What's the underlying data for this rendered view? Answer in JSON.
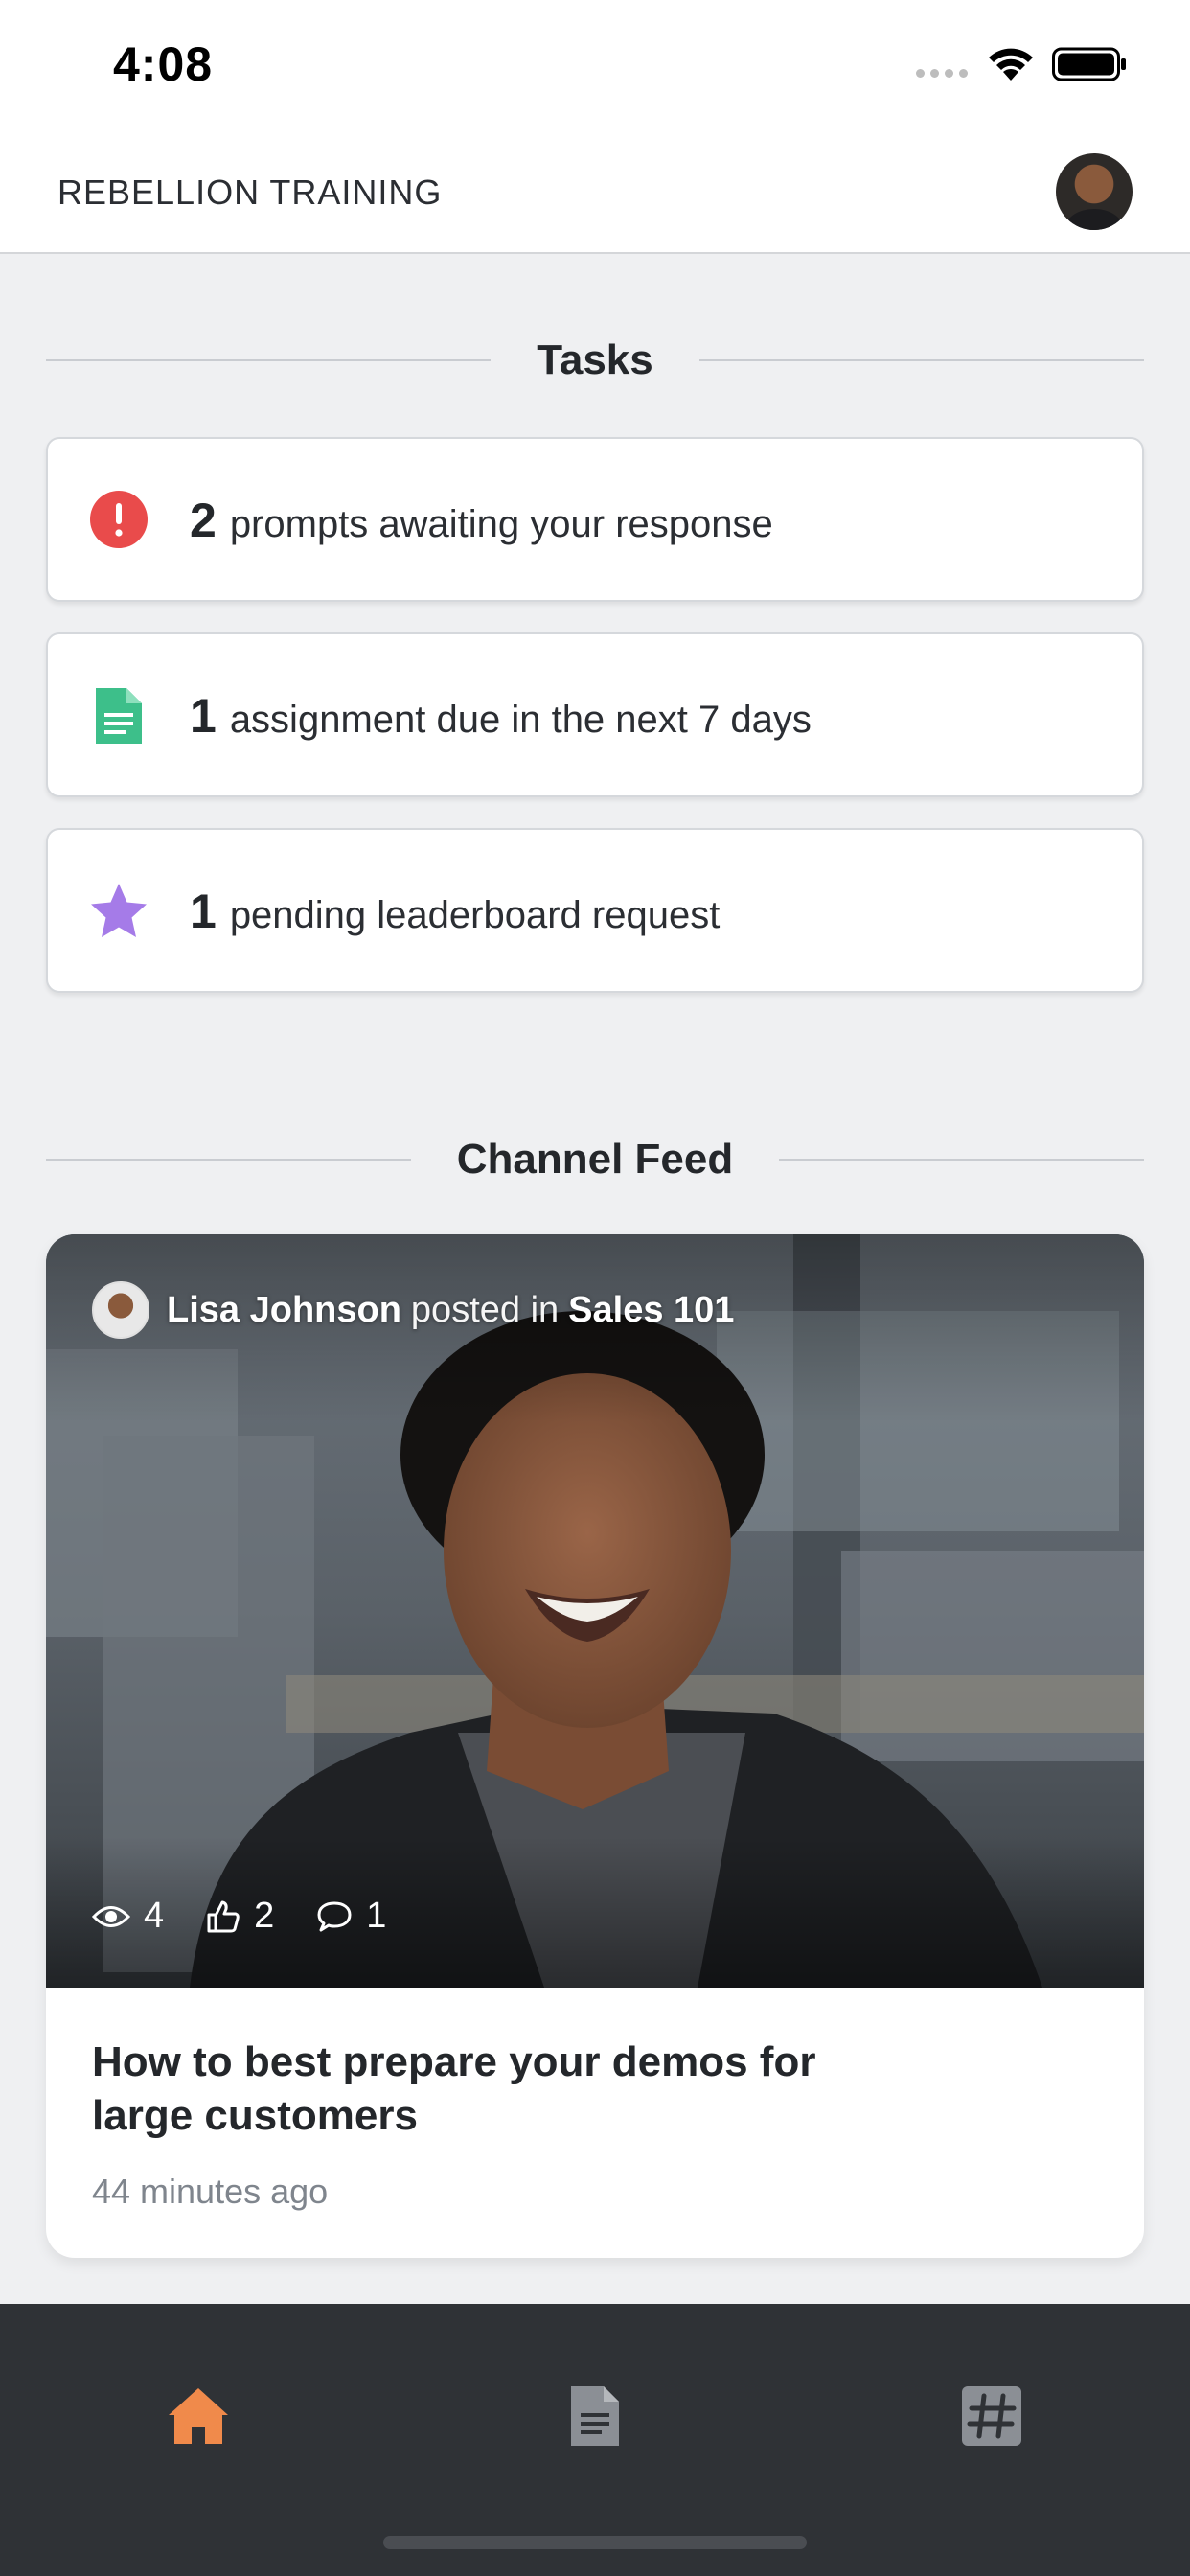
{
  "status_bar": {
    "time": "4:08"
  },
  "header": {
    "title": "REBELLION TRAINING"
  },
  "tasks_section": {
    "heading": "Tasks",
    "items": [
      {
        "count": "2",
        "text": "prompts awaiting your response",
        "icon": "alert-icon",
        "color": "#e94b4b"
      },
      {
        "count": "1",
        "text": "assignment due in the next 7 days",
        "icon": "document-icon",
        "color": "#3dbf8a"
      },
      {
        "count": "1",
        "text": "pending leaderboard request",
        "icon": "star-icon",
        "color": "#a57be8"
      }
    ]
  },
  "feed_section": {
    "heading": "Channel Feed",
    "post": {
      "author": "Lisa Johnson",
      "verb": "posted in",
      "channel": "Sales 101",
      "views": "4",
      "likes": "2",
      "comments": "1",
      "title": "How to best prepare your demos for large customers",
      "time_ago": "44 minutes ago"
    }
  },
  "bottom_nav": {
    "items": [
      {
        "name": "home",
        "icon": "home-icon",
        "active": true
      },
      {
        "name": "documents",
        "icon": "document-icon",
        "active": false
      },
      {
        "name": "channels",
        "icon": "hashtag-icon",
        "active": false
      }
    ],
    "active_color": "#f08a4b",
    "inactive_color": "#8b8f95"
  }
}
